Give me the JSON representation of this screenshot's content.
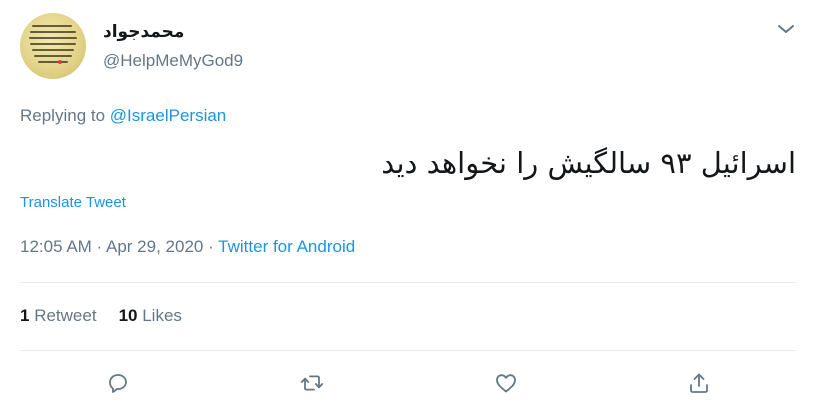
{
  "user": {
    "display_name": "محمدجواد",
    "handle": "@HelpMeMyGod9",
    "avatar_text": "به کسی که گفته خواهد شکست همان کسی است که آن را ساخته است"
  },
  "reply": {
    "prefix": "Replying to ",
    "mention": "@IsraelPersian"
  },
  "tweet": {
    "text": "اسرائیل ۹۳ سالگیش را نخواهد دید"
  },
  "translate_label": "Translate Tweet",
  "meta": {
    "time": "12:05 AM",
    "sep1": " · ",
    "date": "Apr 29, 2020",
    "sep2": " · ",
    "source": "Twitter for Android"
  },
  "stats": {
    "retweets_count": "1",
    "retweets_label": " Retweet",
    "likes_count": "10",
    "likes_label": " Likes"
  },
  "icons": {
    "reply": "reply-icon",
    "retweet": "retweet-icon",
    "like": "heart-icon",
    "share": "share-icon",
    "caret": "chevron-down-icon"
  },
  "colors": {
    "link": "#1b95e0",
    "secondary": "#657786",
    "text": "#14171a",
    "divider": "#e6ecf0"
  }
}
